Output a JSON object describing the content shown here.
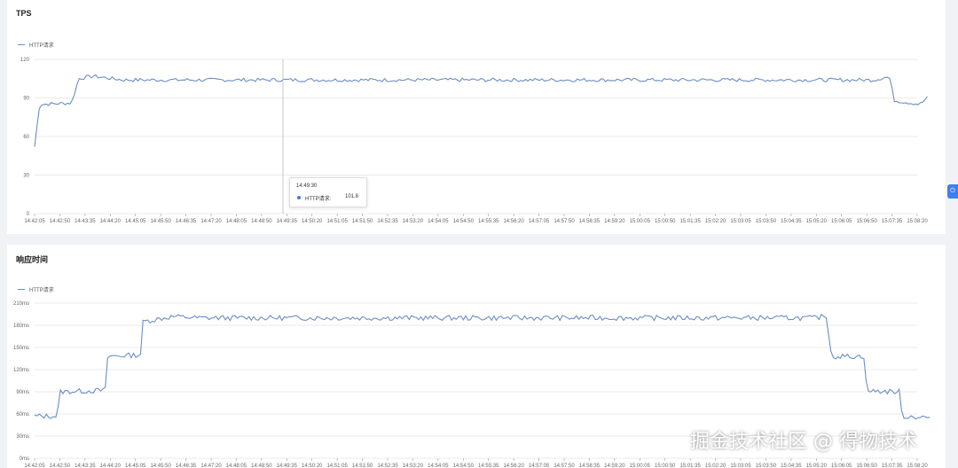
{
  "chart_data": [
    {
      "type": "line",
      "title": "TPS",
      "legend": "top-left",
      "series": [
        {
          "name": "HTTP请求",
          "color": "#6c8ec4"
        }
      ],
      "ylim": [
        0,
        120
      ],
      "yticks": [
        "120",
        "90",
        "60",
        "30",
        "0"
      ],
      "yvalues": [
        120,
        90,
        60,
        30,
        0
      ],
      "xticks": [
        "14:42:05",
        "14:42:50",
        "14:43:35",
        "14:44:20",
        "14:45:05",
        "14:45:50",
        "14:46:35",
        "14:47:20",
        "14:48:05",
        "14:48:50",
        "14:49:35",
        "14:50:20",
        "14:51:05",
        "14:51:50",
        "14:52:35",
        "14:53:20",
        "14:54:05",
        "14:54:50",
        "14:55:35",
        "14:56:20",
        "14:57:05",
        "14:57:50",
        "14:58:35",
        "14:59:20",
        "15:00:05",
        "15:00:50",
        "15:01:35",
        "15:02:20",
        "15:03:05",
        "15:03:50",
        "15:04:35",
        "15:05:20",
        "15:06:05",
        "15:06:50",
        "15:07:35",
        "15:08:20"
      ],
      "profile": [
        [
          0,
          52
        ],
        [
          0.2,
          85
        ],
        [
          1.4,
          86
        ],
        [
          1.5,
          88
        ],
        [
          1.75,
          105
        ],
        [
          2.3,
          107
        ],
        [
          3.5,
          104
        ],
        [
          33.3,
          104
        ],
        [
          33.7,
          106
        ],
        [
          33.9,
          106
        ],
        [
          34.1,
          88
        ],
        [
          34.8,
          86
        ],
        [
          35.1,
          85
        ],
        [
          35.4,
          90
        ]
      ],
      "noise": 1.4,
      "tooltip": {
        "time": "14:49:30",
        "series": "HTTP请求:",
        "value": "101.8"
      }
    },
    {
      "type": "line",
      "title": "响应时间",
      "legend": "top-left",
      "series": [
        {
          "name": "HTTP请求",
          "color": "#6c8ec4"
        }
      ],
      "ylim": [
        0,
        210
      ],
      "yticks": [
        "210ms",
        "180ms",
        "150ms",
        "120ms",
        "90ms",
        "60ms",
        "30ms",
        "0ms"
      ],
      "yvalues": [
        210,
        180,
        150,
        120,
        90,
        60,
        30,
        0
      ],
      "xticks": [
        "14:42:05",
        "14:42:50",
        "14:43:35",
        "14:44:20",
        "14:45:05",
        "14:45:50",
        "14:46:35",
        "14:47:20",
        "14:48:05",
        "14:48:50",
        "14:49:35",
        "14:50:20",
        "14:51:05",
        "14:51:50",
        "14:52:35",
        "14:53:20",
        "14:54:05",
        "14:54:50",
        "14:55:35",
        "14:56:20",
        "14:57:05",
        "14:57:50",
        "14:58:35",
        "14:59:20",
        "15:00:05",
        "15:00:50",
        "15:01:35",
        "15:02:20",
        "15:03:05",
        "15:03:50",
        "15:04:35",
        "15:05:20",
        "15:06:05",
        "15:06:50",
        "15:07:35",
        "15:08:20"
      ],
      "profile": [
        [
          0,
          57
        ],
        [
          0.9,
          57
        ],
        [
          1.0,
          90
        ],
        [
          2.8,
          92
        ],
        [
          2.9,
          138
        ],
        [
          4.2,
          140
        ],
        [
          4.3,
          185
        ],
        [
          5.5,
          192
        ],
        [
          6.5,
          190
        ],
        [
          31.0,
          190
        ],
        [
          31.4,
          193
        ],
        [
          31.6,
          138
        ],
        [
          32.9,
          138
        ],
        [
          33.0,
          91
        ],
        [
          34.3,
          90
        ],
        [
          34.4,
          57
        ],
        [
          35.5,
          55
        ]
      ],
      "noise": 3.5
    }
  ],
  "watermark": "掘金技术社区 @ 得物技术",
  "side_button": "⏻"
}
